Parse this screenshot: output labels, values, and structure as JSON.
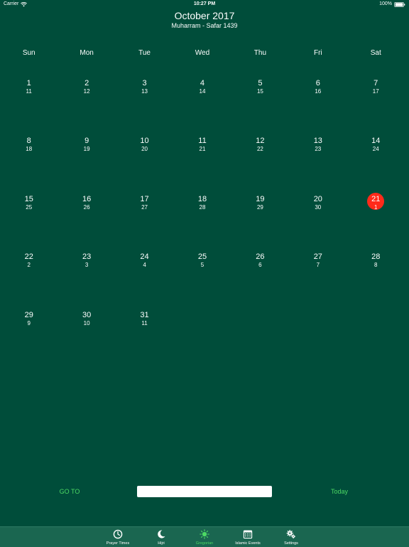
{
  "status_bar": {
    "carrier": "Carrier",
    "time": "10:27 PM",
    "battery": "100%"
  },
  "header": {
    "month_title": "October 2017",
    "hijri_subtitle": "Muharram - Safar 1439"
  },
  "weekdays": [
    "Sun",
    "Mon",
    "Tue",
    "Wed",
    "Thu",
    "Fri",
    "Sat"
  ],
  "calendar": {
    "today_day": "21",
    "weeks": [
      [
        {
          "day": "1",
          "hijri": "11"
        },
        {
          "day": "2",
          "hijri": "12"
        },
        {
          "day": "3",
          "hijri": "13"
        },
        {
          "day": "4",
          "hijri": "14"
        },
        {
          "day": "5",
          "hijri": "15"
        },
        {
          "day": "6",
          "hijri": "16"
        },
        {
          "day": "7",
          "hijri": "17"
        }
      ],
      [
        {
          "day": "8",
          "hijri": "18"
        },
        {
          "day": "9",
          "hijri": "19"
        },
        {
          "day": "10",
          "hijri": "20"
        },
        {
          "day": "11",
          "hijri": "21"
        },
        {
          "day": "12",
          "hijri": "22"
        },
        {
          "day": "13",
          "hijri": "23"
        },
        {
          "day": "14",
          "hijri": "24"
        }
      ],
      [
        {
          "day": "15",
          "hijri": "25"
        },
        {
          "day": "16",
          "hijri": "26"
        },
        {
          "day": "17",
          "hijri": "27"
        },
        {
          "day": "18",
          "hijri": "28"
        },
        {
          "day": "19",
          "hijri": "29"
        },
        {
          "day": "20",
          "hijri": "30"
        },
        {
          "day": "21",
          "hijri": "1"
        }
      ],
      [
        {
          "day": "22",
          "hijri": "2"
        },
        {
          "day": "23",
          "hijri": "3"
        },
        {
          "day": "24",
          "hijri": "4"
        },
        {
          "day": "25",
          "hijri": "5"
        },
        {
          "day": "26",
          "hijri": "6"
        },
        {
          "day": "27",
          "hijri": "7"
        },
        {
          "day": "28",
          "hijri": "8"
        }
      ],
      [
        {
          "day": "29",
          "hijri": "9"
        },
        {
          "day": "30",
          "hijri": "10"
        },
        {
          "day": "31",
          "hijri": "11"
        },
        null,
        null,
        null,
        null
      ]
    ]
  },
  "goto": {
    "goto_label": "GO TO",
    "input_value": "",
    "today_label": "Today"
  },
  "colors": {
    "background": "#004d3a",
    "tab_bar": "#1a6650",
    "accent": "#4cd964",
    "today_marker": "#ff2a1a"
  },
  "tab_bar": {
    "active_index": 2,
    "tabs": [
      {
        "label": "Prayer Times",
        "icon": "clock-icon"
      },
      {
        "label": "Hijri",
        "icon": "crescent-moon-icon"
      },
      {
        "label": "Gregorian",
        "icon": "sun-icon"
      },
      {
        "label": "Islamic Events",
        "icon": "calendar-icon"
      },
      {
        "label": "Settings",
        "icon": "gears-icon"
      }
    ]
  }
}
